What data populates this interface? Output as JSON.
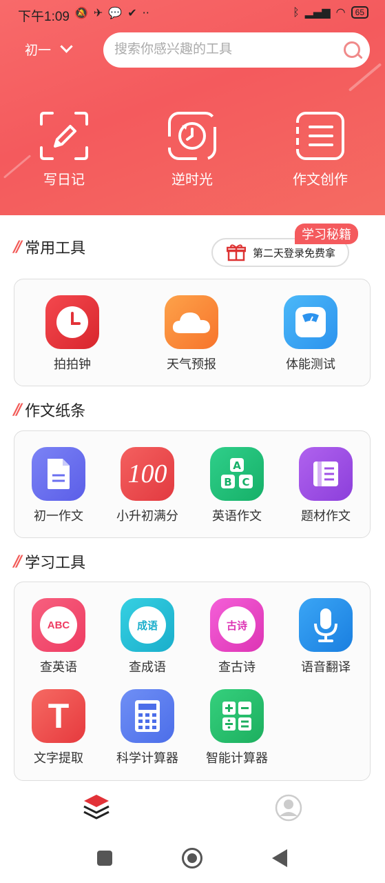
{
  "status": {
    "time": "下午1:09",
    "battery": "65"
  },
  "header": {
    "grade": "初一",
    "search_placeholder": "搜索你感兴趣的工具"
  },
  "hero_items": [
    {
      "label": "写日记",
      "icon": "pencil-icon"
    },
    {
      "label": "逆时光",
      "icon": "rewind-clock-icon"
    },
    {
      "label": "作文创作",
      "icon": "list-doc-icon"
    }
  ],
  "sections": {
    "common": "常用工具",
    "essay": "作文纸条",
    "study": "学习工具"
  },
  "promo": {
    "badge": "学习秘籍",
    "button": "第二天登录免费拿"
  },
  "common_tools": [
    {
      "label": "拍拍钟",
      "icon": "clock-icon",
      "color": "#e9353b"
    },
    {
      "label": "天气预报",
      "icon": "cloud-icon",
      "color": "#fb8f3a"
    },
    {
      "label": "体能测试",
      "icon": "scale-icon",
      "color": "#3aa6f5"
    }
  ],
  "essay_tools": [
    {
      "label": "初一作文",
      "icon": "document-icon",
      "color": "#6a6ff0"
    },
    {
      "label": "小升初满分",
      "icon": "hundred-icon",
      "color": "#ef4b4f",
      "text": "100"
    },
    {
      "label": "英语作文",
      "icon": "abc-blocks-icon",
      "color": "#22c07b"
    },
    {
      "label": "题材作文",
      "icon": "book-icon",
      "color": "#a150e5"
    }
  ],
  "study_tools": [
    {
      "label": "查英语",
      "icon": "abc-search-icon",
      "color": "#f2466d",
      "text": "ABC"
    },
    {
      "label": "查成语",
      "icon": "idiom-search-icon",
      "color": "#26c2d8",
      "text": "成语"
    },
    {
      "label": "查古诗",
      "icon": "poem-search-icon",
      "color": "#ee4bc9",
      "text": "古诗"
    },
    {
      "label": "语音翻译",
      "icon": "microphone-icon",
      "color": "#2390e8"
    },
    {
      "label": "文字提取",
      "icon": "text-t-icon",
      "color": "#f04f4f",
      "text": "T"
    },
    {
      "label": "科学计算器",
      "icon": "calculator-icon",
      "color": "#5a7bf0"
    },
    {
      "label": "智能计算器",
      "icon": "math-ops-icon",
      "color": "#25be6a"
    }
  ]
}
